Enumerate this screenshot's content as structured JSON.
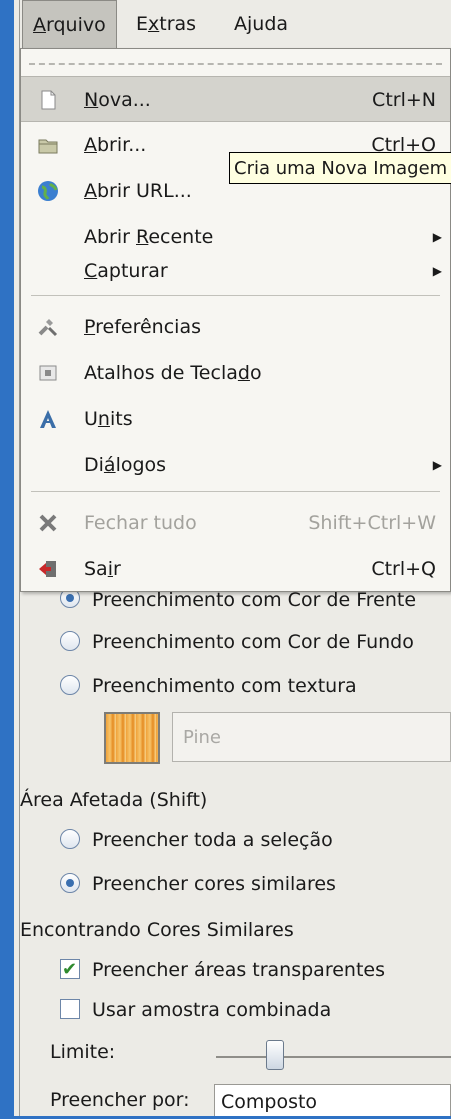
{
  "menubar": {
    "items": [
      {
        "pre": "",
        "key": "A",
        "post": "rquivo"
      },
      {
        "pre": "E",
        "key": "x",
        "post": "tras"
      },
      {
        "pre": "A",
        "key": "j",
        "post": "uda"
      }
    ]
  },
  "file_menu": {
    "items": [
      {
        "pre": "",
        "key": "N",
        "post": "ova...",
        "accel": "Ctrl+N",
        "icon": "new-document-icon"
      },
      {
        "pre": "",
        "key": "A",
        "post": "brir...",
        "accel": "Ctrl+O",
        "icon": "folder-open-icon"
      },
      {
        "pre": "",
        "key": "A",
        "post": "brir URL...",
        "accel": "",
        "icon": "globe-icon"
      },
      {
        "pre": "Abrir ",
        "key": "R",
        "post": "ecente",
        "accel": "",
        "icon": ""
      },
      {
        "pre": "",
        "key": "C",
        "post": "apturar",
        "accel": "",
        "icon": ""
      },
      {
        "pre": "",
        "key": "P",
        "post": "referências",
        "accel": "",
        "icon": "preferences-icon"
      },
      {
        "pre": "Atalhos de Tecla",
        "key": "d",
        "post": "o",
        "accel": "",
        "icon": "keyboard-icon"
      },
      {
        "pre": "U",
        "key": "n",
        "post": "its",
        "accel": "",
        "icon": "units-icon"
      },
      {
        "pre": "Di",
        "key": "á",
        "post": "logos",
        "accel": "",
        "icon": ""
      },
      {
        "pre": "Fechar tudo",
        "key": "",
        "post": "",
        "accel": "Shift+Ctrl+W",
        "icon": "close-all-icon"
      },
      {
        "pre": "Sa",
        "key": "i",
        "post": "r",
        "accel": "Ctrl+Q",
        "icon": "quit-icon"
      }
    ]
  },
  "tooltip": {
    "text": "Cria uma Nova Imagem"
  },
  "fill_panel": {
    "fill_types": [
      "Preenchimento com Cor de Frente",
      "Preenchimento com Cor de Fundo",
      "Preenchimento com textura"
    ],
    "pattern_name": "Pine",
    "affected_area_label": "Área Afetada (Shift)",
    "affected_area_options": [
      "Preencher toda a seleção",
      "Preencher cores similares"
    ],
    "similar_colors_label": "Encontrando Cores Similares",
    "checkbox_transparent": "Preencher áreas transparentes",
    "checkbox_sample_merged": "Usar amostra combinada",
    "threshold_label": "Limite:",
    "fill_by_label": "Preencher por:",
    "fill_by_value": "Composto"
  }
}
